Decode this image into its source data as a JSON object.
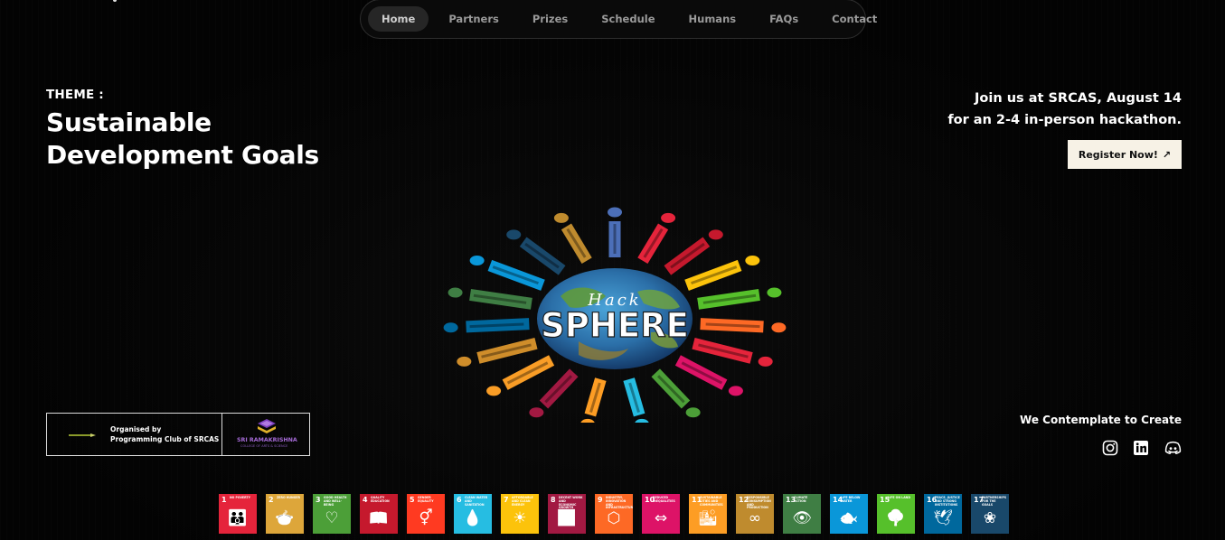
{
  "nav": {
    "items": [
      {
        "label": "Home",
        "active": true
      },
      {
        "label": "Partners",
        "active": false
      },
      {
        "label": "Prizes",
        "active": false
      },
      {
        "label": "Schedule",
        "active": false
      },
      {
        "label": "Humans",
        "active": false
      },
      {
        "label": "FAQs",
        "active": false
      },
      {
        "label": "Contact",
        "active": false
      }
    ]
  },
  "theme": {
    "label": "THEME :",
    "title": "Sustainable Development Goals"
  },
  "cta": {
    "line1": "Join us at SRCAS, August 14",
    "line2": "for an 2-4 in-person hackathon.",
    "register_label": "Register Now!",
    "register_icon": "arrow-up-right-icon"
  },
  "hero": {
    "logo_text_top": "Hack",
    "logo_text_main": "SPHERE",
    "figure_colors": [
      "#4c6fb8",
      "#e5243b",
      "#c5192d",
      "#fcc30b",
      "#56c02b",
      "#fd6925",
      "#e5243b",
      "#dd1367",
      "#4c9f38",
      "#26bde2",
      "#fd9d24",
      "#a21942",
      "#f99d26",
      "#cf8d2a",
      "#00689d",
      "#3f7e44",
      "#0a97d9",
      "#19486a",
      "#bf8b2e"
    ]
  },
  "organiser": {
    "line1": "Organised by",
    "line2": "Programming Club of SRCAS",
    "college_name": "SRI RAMAKRISHNA",
    "college_sub": "COLLEGE OF ARTS & SCIENCE"
  },
  "tagline": "We Contemplate to Create",
  "social": [
    {
      "icon": "instagram-icon"
    },
    {
      "icon": "linkedin-icon"
    },
    {
      "icon": "discord-icon"
    }
  ],
  "sdg_tiles": [
    {
      "num": "1",
      "label": "NO POVERTY",
      "color": "#e5243b"
    },
    {
      "num": "2",
      "label": "ZERO HUNGER",
      "color": "#dda63a"
    },
    {
      "num": "3",
      "label": "GOOD HEALTH AND WELL-BEING",
      "color": "#4c9f38"
    },
    {
      "num": "4",
      "label": "QUALITY EDUCATION",
      "color": "#c5192d"
    },
    {
      "num": "5",
      "label": "GENDER EQUALITY",
      "color": "#ff3a21"
    },
    {
      "num": "6",
      "label": "CLEAN WATER AND SANITATION",
      "color": "#26bde2"
    },
    {
      "num": "7",
      "label": "AFFORDABLE AND CLEAN ENERGY",
      "color": "#fcc30b"
    },
    {
      "num": "8",
      "label": "DECENT WORK AND ECONOMIC GROWTH",
      "color": "#a21942"
    },
    {
      "num": "9",
      "label": "INDUSTRY, INNOVATION AND INFRASTRUCTURE",
      "color": "#fd6925"
    },
    {
      "num": "10",
      "label": "REDUCED INEQUALITIES",
      "color": "#dd1367"
    },
    {
      "num": "11",
      "label": "SUSTAINABLE CITIES AND COMMUNITIES",
      "color": "#fd9d24"
    },
    {
      "num": "12",
      "label": "RESPONSIBLE CONSUMPTION AND PRODUCTION",
      "color": "#bf8b2e"
    },
    {
      "num": "13",
      "label": "CLIMATE ACTION",
      "color": "#3f7e44"
    },
    {
      "num": "14",
      "label": "LIFE BELOW WATER",
      "color": "#0a97d9"
    },
    {
      "num": "15",
      "label": "LIFE ON LAND",
      "color": "#56c02b"
    },
    {
      "num": "16",
      "label": "PEACE, JUSTICE AND STRONG INSTITUTIONS",
      "color": "#00689d"
    },
    {
      "num": "17",
      "label": "PARTNERSHIPS FOR THE GOALS",
      "color": "#19486a"
    }
  ]
}
